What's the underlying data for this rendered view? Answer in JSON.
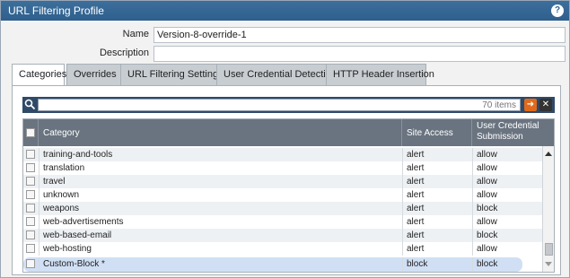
{
  "dialog": {
    "title": "URL Filtering Profile"
  },
  "form": {
    "name_label": "Name",
    "name_value": "Version-8-override-1",
    "description_label": "Description",
    "description_value": ""
  },
  "tabs": [
    {
      "label": "Categories",
      "active": true
    },
    {
      "label": "Overrides"
    },
    {
      "label": "URL Filtering Settings"
    },
    {
      "label": "User Credential Detection"
    },
    {
      "label": "HTTP Header Insertion"
    }
  ],
  "search": {
    "count_text": "70 items",
    "go_glyph": "➜",
    "clear_glyph": "✕"
  },
  "grid": {
    "columns": [
      "Category",
      "Site Access",
      "User Credential Submission"
    ],
    "rows": [
      {
        "category": "training-and-tools",
        "site_access": "alert",
        "credential": "allow"
      },
      {
        "category": "translation",
        "site_access": "alert",
        "credential": "allow"
      },
      {
        "category": "travel",
        "site_access": "alert",
        "credential": "allow"
      },
      {
        "category": "unknown",
        "site_access": "alert",
        "credential": "allow"
      },
      {
        "category": "weapons",
        "site_access": "alert",
        "credential": "block"
      },
      {
        "category": "web-advertisements",
        "site_access": "alert",
        "credential": "allow"
      },
      {
        "category": "web-based-email",
        "site_access": "alert",
        "credential": "block"
      },
      {
        "category": "web-hosting",
        "site_access": "alert",
        "credential": "allow"
      },
      {
        "category": "Custom-Block *",
        "site_access": "block",
        "credential": "block"
      }
    ]
  }
}
